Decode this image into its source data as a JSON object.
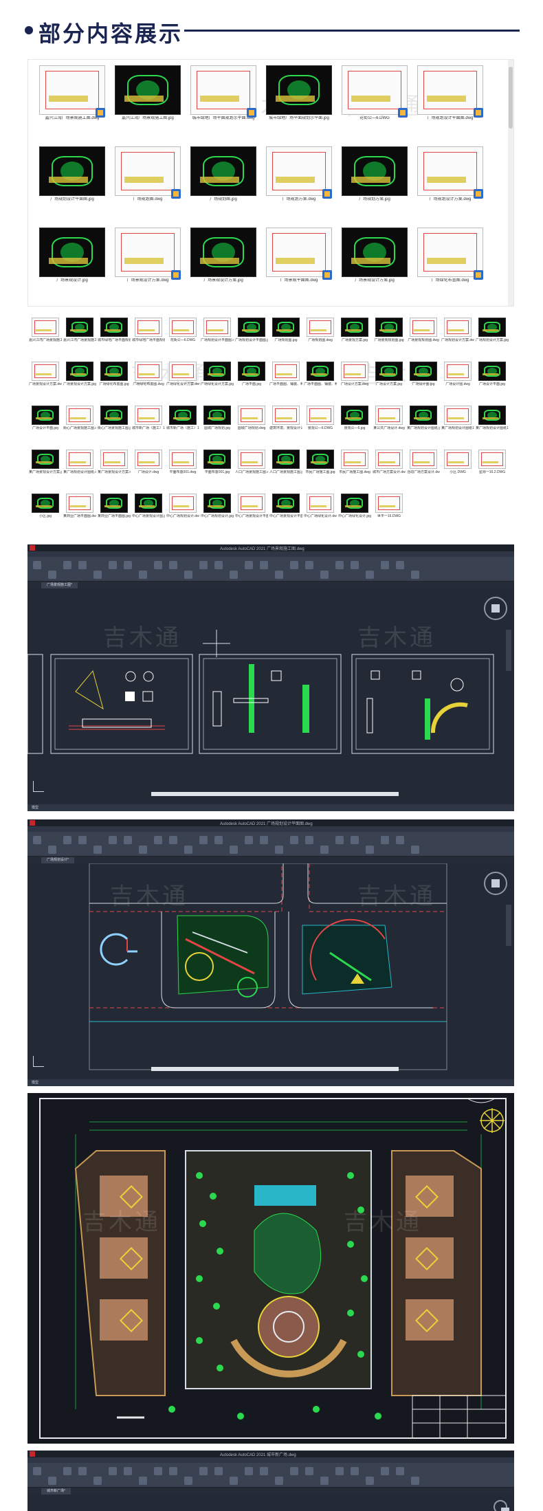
{
  "header": {
    "title": "部分内容展示"
  },
  "watermark_text": "吉木通",
  "large_files": [
    {
      "name": "嘉兴江湾广场景观施工图.dwg",
      "theme": "light"
    },
    {
      "name": "嘉兴江湾广场景观施工图.jpg",
      "theme": "dark"
    },
    {
      "name": "城市绿地广场平面规划示平面.dwg",
      "theme": "light"
    },
    {
      "name": "城市绿地广场平面规划示平面.jpg",
      "theme": "dark"
    },
    {
      "name": "花街公—6.DWG",
      "theme": "light"
    },
    {
      "name": "广场规划设计平面图.dwg",
      "theme": "light"
    },
    {
      "name": "广场规划设计平面图.jpg",
      "theme": "dark"
    },
    {
      "name": "广场规划图.dwg",
      "theme": "light"
    },
    {
      "name": "广场规划图.jpg",
      "theme": "dark"
    },
    {
      "name": "广场规划方案.dwg",
      "theme": "light"
    },
    {
      "name": "广场规划方案.jpg",
      "theme": "dark"
    },
    {
      "name": "广场规划设计方案.dwg",
      "theme": "light"
    },
    {
      "name": "广场景观设计.jpg",
      "theme": "dark"
    },
    {
      "name": "广场景观设计方案.dwg",
      "theme": "light"
    },
    {
      "name": "广场景观设计方案.jpg",
      "theme": "dark"
    },
    {
      "name": "广场景观平面图.dwg",
      "theme": "light"
    },
    {
      "name": "广场景观设计方案.jpg",
      "theme": "dark"
    },
    {
      "name": "广场绿化布置图.dwg",
      "theme": "light"
    }
  ],
  "small_files": [
    "嘉兴江湾广场景观施工图.dwg",
    "嘉兴江湾广场景观施工图.jpg",
    "城市绿地广场平面规划示平面.jpg",
    "城市绿地广场平面规划示平面.dwg",
    "花街公—6.DWG",
    "广场规划设计平面图.dwg",
    "广场规划设计平面图.jpg",
    "广场规划图.jpg",
    "广场规划图.dwg",
    "广场景观方案.jpg",
    "广场景观规划图.jpg",
    "广场景观规划图.dwg",
    "广场规划设计方案.dwg",
    "广场规划设计方案.jpg",
    "广场景观设计方案.dwg",
    "广场景观设计方案.jpg",
    "广场绿化布置图.jpg",
    "广场绿化布置图.dwg",
    "广场绿化设计方案.dwg",
    "广场绿化设计方案.jpg",
    "广场平面.jpg",
    "广场平面图、铺装、种植做法.dwg",
    "广场平面图、铺装、种植做法.jpg",
    "广场设计方案.dwg",
    "广场设计方案.jpg",
    "广场设计图.jpg",
    "广场设计图.dwg",
    "广场设计平面.jpg",
    "广场设计平面.jpg",
    "街心广场景观施工图.dwg",
    "街心广场景观施工图.jpg",
    "城市新广场（施工）1.dwg",
    "城市新广场（施工）1.jpg",
    "圆城广场规划.jpg",
    "圆城广场规划.dwg",
    "建筑环境、景观设计公共空间设计.dwg",
    "景观公—6.DWG",
    "景观公—6.jpg",
    "某公共广场设计.dwg",
    "某广场规划设计图纸.jpg",
    "某广场规划设计图纸1.dwg",
    "某广场规划设计图纸1.jpg",
    "某广场景观设计方案.jpg",
    "某广场规划设计图纸.dwg",
    "某广场景观设计方案.dwg",
    "广场设计.dwg",
    "平面布置001.dwg",
    "平面布置001.jpg",
    "人口广场景观施工图.dwg",
    "人口广场景观施工图.jpg",
    "市民广场施工图.jpg",
    "市民广场施工图.dwg",
    "城市广场方案设计.dwg",
    "活动广场方案设计.dwg",
    "小区.DWG",
    "星际一16.2.DWG",
    "小区.jpg",
    "某商业广场平面图.dwg",
    "某商业广场平面图.jpg",
    "中心广场景观设计图.jpg",
    "中心广场规划设计.dwg",
    "中心广场规划设计.jpg",
    "中心广场景观设计平面图.dwg",
    "中心广场景观设计平面图.jpg",
    "中心广场绿化设计.dwg",
    "中心广场绿化设计.jpg",
    "世平一16.DWG"
  ],
  "cad1": {
    "app_title": "Autodesk AutoCAD 2021  广场景观施工图.dwg",
    "tabs": [
      "默认",
      "插入",
      "注释",
      "参数化",
      "视图",
      "管理",
      "输出",
      "附加模块",
      "协作",
      "精选应用"
    ],
    "doc_tab": "广场景观施工图*",
    "status_tab": "模型"
  },
  "cad2": {
    "app_title": "Autodesk AutoCAD 2021  广场规划设计平面图.dwg",
    "tabs": [
      "默认",
      "插入",
      "注释",
      "参数化",
      "视图",
      "管理",
      "输出",
      "附加模块",
      "协作",
      "精选应用"
    ],
    "doc_tab": "广场规划设计*",
    "status_tab": "模型"
  },
  "cad3": {
    "app_title": "Autodesk AutoCAD 2021  城市新广场.dwg",
    "tabs": [
      "默认",
      "插入",
      "注释",
      "参数化",
      "视图",
      "管理",
      "输出",
      "附加模块",
      "协作",
      "精选应用"
    ],
    "doc_tab": "城市新广场*",
    "status_tab": "模型"
  },
  "colors": {
    "brand": "#1a2450",
    "cad_bg": "#232a35",
    "plan_bg": "#15181e",
    "green": "#2bd94f",
    "yellow": "#e8d23a",
    "red": "#e04646"
  }
}
